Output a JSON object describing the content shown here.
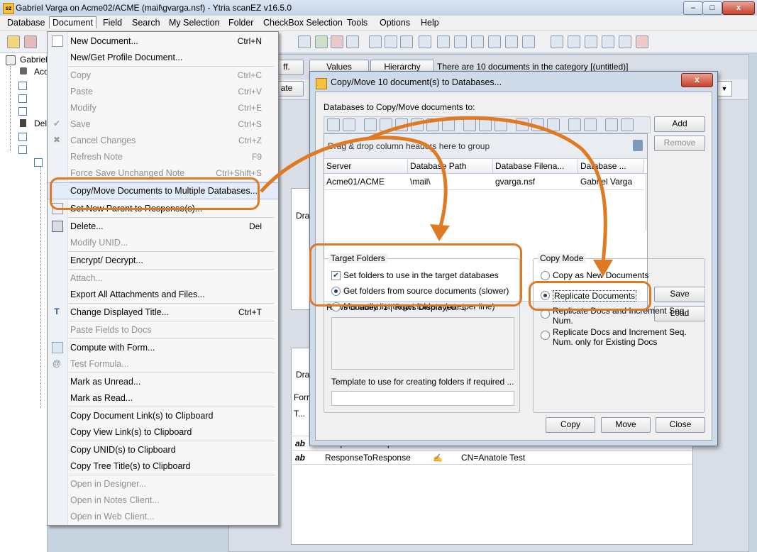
{
  "window": {
    "title": "Gabriel Varga on Acme02/ACME (mail\\gvarga.nsf) - Ytria scanEZ v16.5.0",
    "icon_text": "sz",
    "minimize": "–",
    "maximize": "□",
    "close": "x"
  },
  "menubar": [
    "Database",
    "Document",
    "Field",
    "Search",
    "My Selection",
    "Folder",
    "CheckBox Selection",
    "Tools",
    "Options",
    "Help"
  ],
  "tree": {
    "root": "Gabriel",
    "item2": "Acc",
    "item_del": "Del"
  },
  "background": {
    "values_button": "Values",
    "hierarchy_button": "Hierarchy",
    "category_status": "There are 10 documents in the category [(untitled)]",
    "partial_button_1": "ff.",
    "partial_button_2": "ate",
    "drag_label_1": "Dra",
    "drag_label_2": "Dra",
    "form_label": "Forr",
    "t_label": "T...",
    "rows": [
      {
        "icon": "ab",
        "name": "ResponseToResponse",
        "value": "CN=Anatole Test"
      },
      {
        "icon": "ab",
        "name": "ResponseToResponse",
        "value": "CN=Anatole Test"
      }
    ]
  },
  "document_menu": {
    "items": [
      {
        "label": "New Document...",
        "shortcut": "Ctrl+N",
        "disabled": false
      },
      {
        "label": "New/Get Profile Document...",
        "shortcut": "",
        "disabled": false
      },
      {
        "label": "Copy",
        "shortcut": "Ctrl+C",
        "disabled": true
      },
      {
        "label": "Paste",
        "shortcut": "Ctrl+V",
        "disabled": true
      },
      {
        "label": "Modify",
        "shortcut": "Ctrl+E",
        "disabled": true
      },
      {
        "label": "Save",
        "shortcut": "Ctrl+S",
        "disabled": true
      },
      {
        "label": "Cancel Changes",
        "shortcut": "Ctrl+Z",
        "disabled": true
      },
      {
        "label": "Refresh Note",
        "shortcut": "F9",
        "disabled": true
      },
      {
        "label": "Force Save Unchanged Note",
        "shortcut": "Ctrl+Shift+S",
        "disabled": true
      },
      {
        "label": "Copy/Move Documents to Multiple Databases...",
        "shortcut": "",
        "disabled": false
      },
      {
        "label": "Set New Parent to Response(s)...",
        "shortcut": "",
        "disabled": false
      },
      {
        "label": "Delete...",
        "shortcut": "Del",
        "disabled": false
      },
      {
        "label": "Modify UNID...",
        "shortcut": "",
        "disabled": true
      },
      {
        "label": "Encrypt/ Decrypt...",
        "shortcut": "",
        "disabled": false
      },
      {
        "label": "Attach...",
        "shortcut": "",
        "disabled": true
      },
      {
        "label": "Export All Attachments and Files...",
        "shortcut": "",
        "disabled": false
      },
      {
        "label": "Change Displayed Title...",
        "shortcut": "Ctrl+T",
        "disabled": false
      },
      {
        "label": "Paste Fields to Docs",
        "shortcut": "",
        "disabled": true
      },
      {
        "label": "Compute with Form...",
        "shortcut": "",
        "disabled": false
      },
      {
        "label": "Test Formula...",
        "shortcut": "",
        "disabled": true
      },
      {
        "label": "Mark as Unread...",
        "shortcut": "",
        "disabled": false
      },
      {
        "label": "Mark as Read...",
        "shortcut": "",
        "disabled": false
      },
      {
        "label": "Copy Document Link(s) to Clipboard",
        "shortcut": "",
        "disabled": false
      },
      {
        "label": "Copy View Link(s) to Clipboard",
        "shortcut": "",
        "disabled": false
      },
      {
        "label": "Copy UNID(s) to Clipboard",
        "shortcut": "",
        "disabled": false
      },
      {
        "label": "Copy Tree Title(s) to Clipboard",
        "shortcut": "",
        "disabled": false
      },
      {
        "label": "Open in Designer...",
        "shortcut": "",
        "disabled": true
      },
      {
        "label": "Open in Notes Client...",
        "shortcut": "",
        "disabled": true
      },
      {
        "label": "Open in Web Client...",
        "shortcut": "",
        "disabled": true
      }
    ]
  },
  "dialog": {
    "title": "Copy/Move 10 document(s) to Databases...",
    "close": "x",
    "databases_label": "Databases to Copy/Move documents to:",
    "drag_hint": "Drag & drop column headers here to group",
    "columns": [
      "Server",
      "Database Path",
      "Database Filena...",
      "Database ..."
    ],
    "row": [
      "Acme01/ACME",
      "\\mail\\",
      "gvarga.nsf",
      "Gabriel Varga"
    ],
    "status": "Rows Loaded: 1  |  Rows Displayed: 1",
    "add": "Add",
    "remove": "Remove",
    "save": "Save",
    "load": "Load",
    "target_folders": {
      "label": "Target Folders",
      "checkbox": "Set folders to use in the target databases",
      "options": [
        "Get folders from source documents (slower)",
        "Manually list target folders (one per line)"
      ],
      "template_label": "Template to use for creating folders if required ..."
    },
    "copy_mode": {
      "label": "Copy Mode",
      "options": [
        "Copy as New Documents",
        "Replicate Documents",
        "Replicate Docs and Increment Seq. Num.",
        "Replicate Docs and Increment Seq. Num. only for Existing Docs"
      ],
      "selected": 1
    },
    "buttons": {
      "copy": "Copy",
      "move": "Move",
      "close": "Close"
    }
  },
  "colors": {
    "highlight": "#e07a22",
    "dialog_frame": "#cfdbe9"
  }
}
